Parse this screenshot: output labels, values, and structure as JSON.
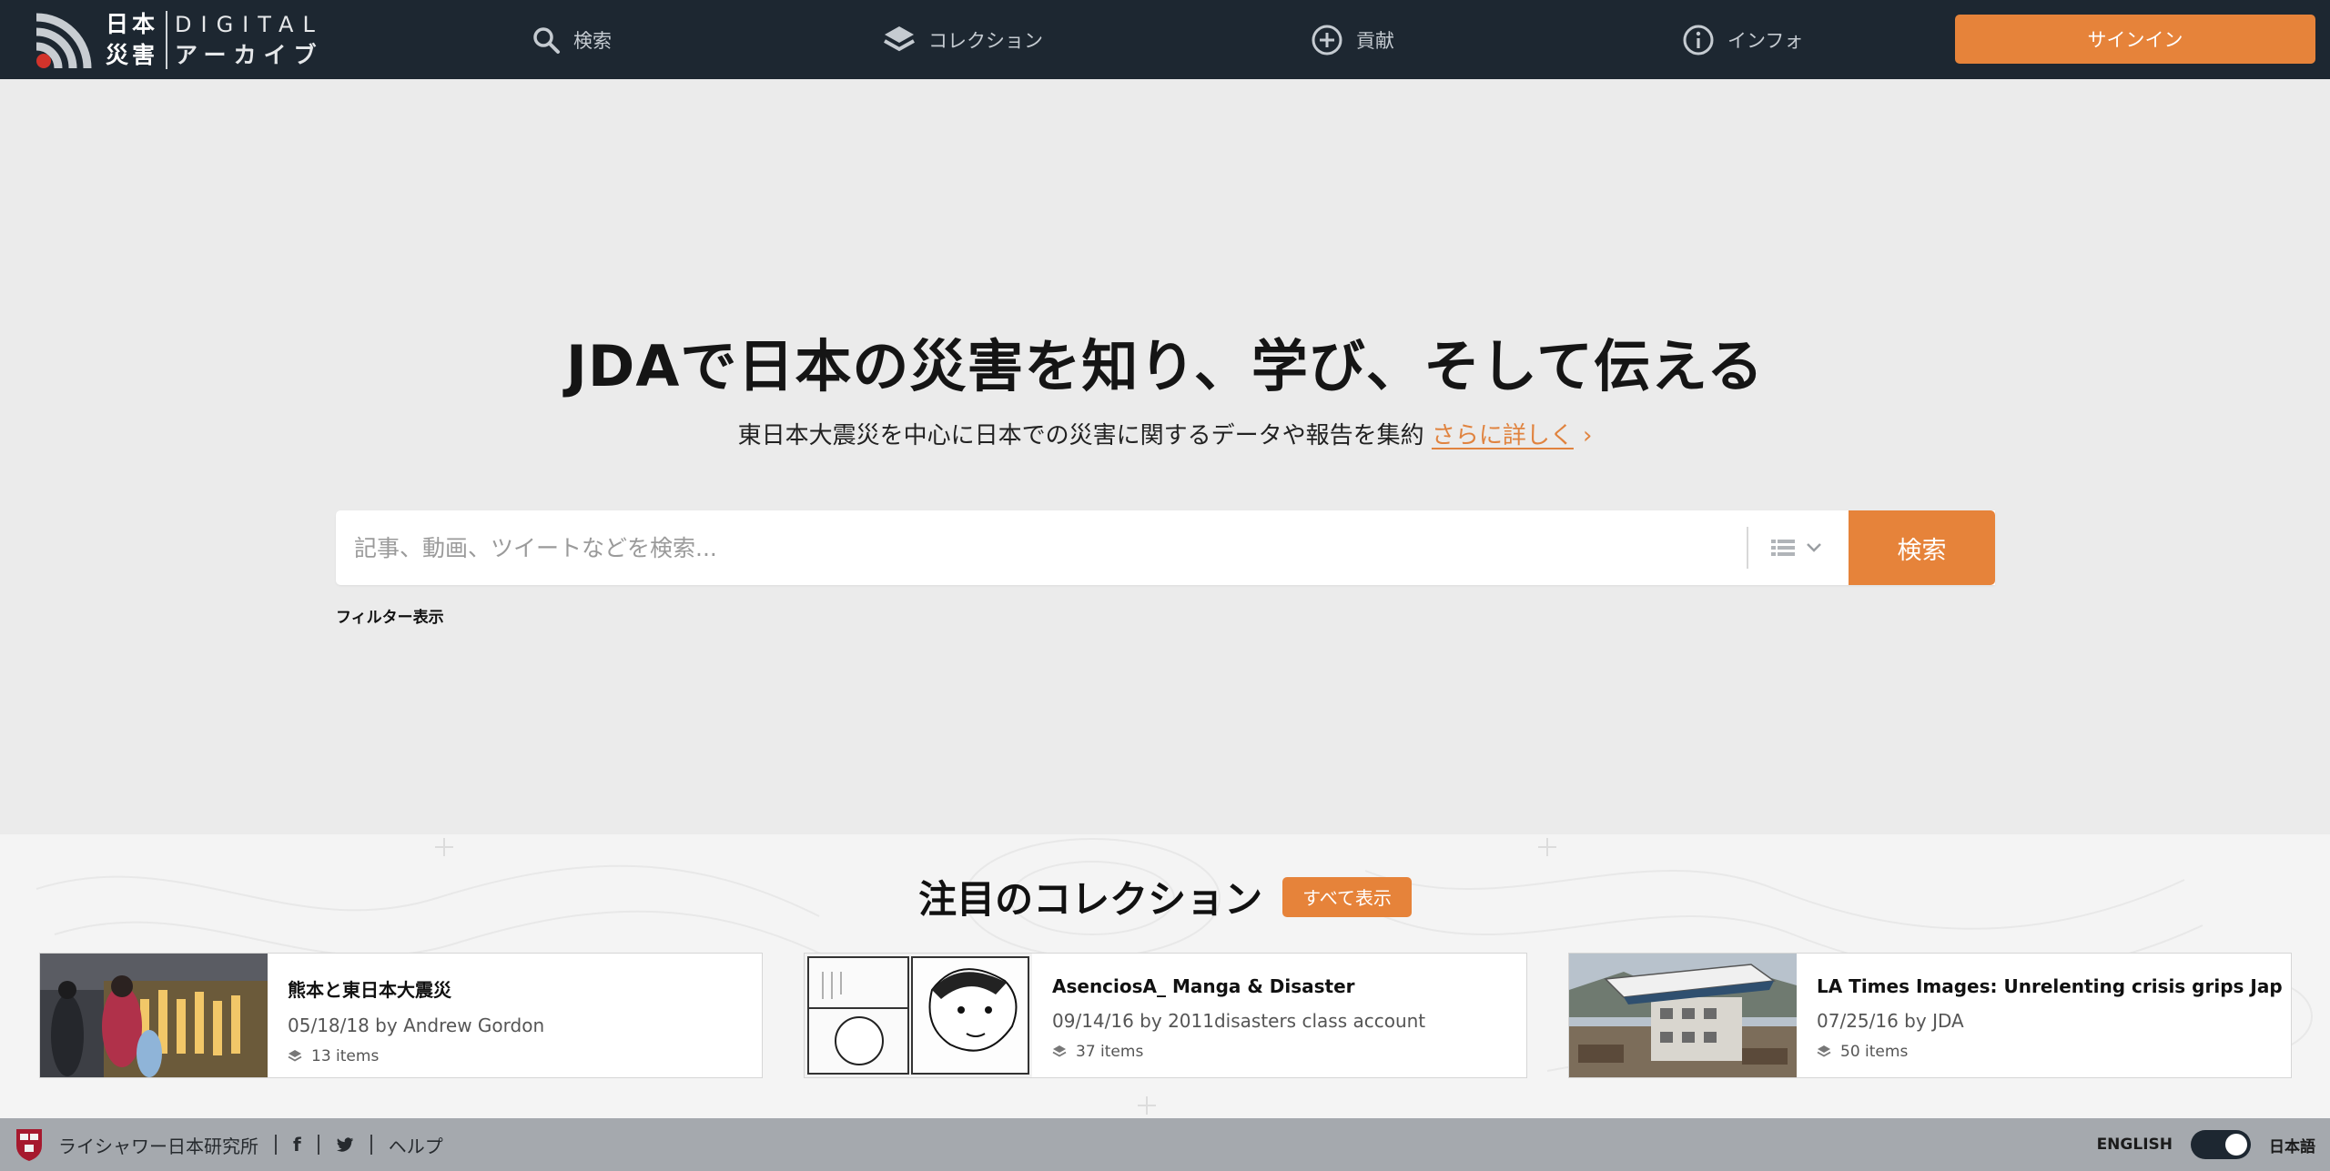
{
  "header": {
    "logo": {
      "jp_top": "日本",
      "jp_bottom": "災害",
      "en_top": "DIGITAL",
      "en_bottom": "アーカイブ"
    },
    "nav": [
      {
        "label": "検索",
        "icon": "search-icon"
      },
      {
        "label": "コレクション",
        "icon": "layers-icon"
      },
      {
        "label": "貢献",
        "icon": "plus-circle-icon"
      },
      {
        "label": "インフォ",
        "icon": "info-icon"
      }
    ],
    "signin_label": "サインイン"
  },
  "hero": {
    "title": "JDAで日本の災害を知り、学び、そして伝える",
    "subtitle": "東日本大震災を中心に日本での災害に関するデータや報告を集約",
    "more_link": "さらに詳しく",
    "more_chevron": "›"
  },
  "search": {
    "placeholder": "記事、動画、ツイートなどを検索...",
    "button_label": "検索",
    "filter_label": "フィルター表示"
  },
  "featured": {
    "title": "注目のコレクション",
    "view_all_label": "すべて表示",
    "cards": [
      {
        "title": "熊本と東日本大震災",
        "meta": "05/18/18 by Andrew Gordon",
        "count": "13 items"
      },
      {
        "title": "AsenciosA_ Manga & Disaster",
        "meta": "09/14/16 by 2011disasters class account",
        "count": "37 items"
      },
      {
        "title": "LA Times Images: Unrelenting crisis grips Japan",
        "meta": "07/25/16 by JDA",
        "count": "50 items"
      }
    ]
  },
  "footer": {
    "institute": "ライシャワー日本研究所",
    "facebook": "f",
    "help": "ヘルプ",
    "lang_en": "ENGLISH",
    "lang_jp": "日本語"
  },
  "colors": {
    "accent": "#e6833a",
    "header_bg": "#1d2731",
    "footer_bg": "#a5a9ae"
  }
}
